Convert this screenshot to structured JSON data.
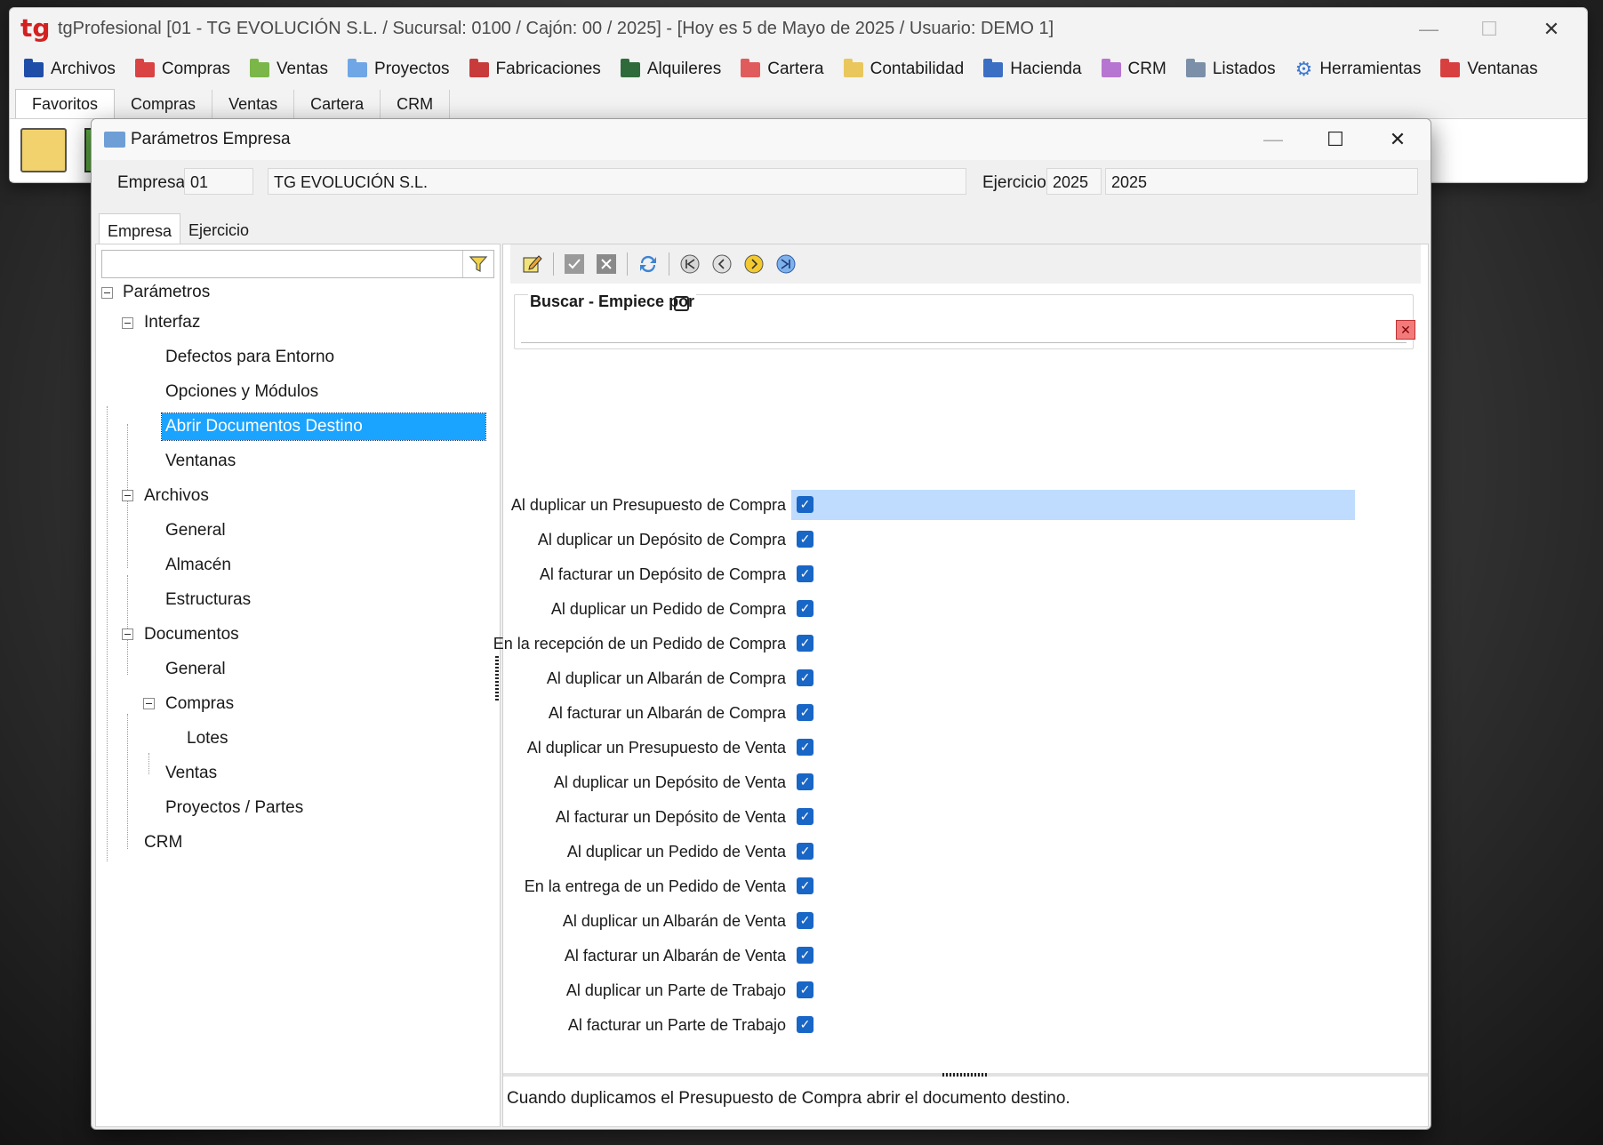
{
  "app": {
    "logo": "tg",
    "title": "tgProfesional [01 - TG EVOLUCIÓN S.L. / Sucursal: 0100 / Cajón: 00 / 2025] - [Hoy es 5 de Mayo de 2025 / Usuario: DEMO 1]",
    "controls": {
      "minimize": "—",
      "maximize": "☐",
      "close": "✕"
    }
  },
  "menu": [
    {
      "label": "Archivos",
      "icon": "folder-blue-icon",
      "color": "#1f4ea8"
    },
    {
      "label": "Compras",
      "icon": "folder-red-icon",
      "color": "#d94343"
    },
    {
      "label": "Ventas",
      "icon": "folder-green-icon",
      "color": "#7ab648"
    },
    {
      "label": "Proyectos",
      "icon": "folder-lightblue-icon",
      "color": "#6fa6e6"
    },
    {
      "label": "Fabricaciones",
      "icon": "factory-icon",
      "color": "#c83b3b"
    },
    {
      "label": "Alquileres",
      "icon": "folder-darkgreen-icon",
      "color": "#2f6b3a"
    },
    {
      "label": "Cartera",
      "icon": "folder-red-icon",
      "color": "#e05c5c"
    },
    {
      "label": "Contabilidad",
      "icon": "folder-yellow-icon",
      "color": "#e9c75d"
    },
    {
      "label": "Hacienda",
      "icon": "hacienda-icon",
      "color": "#3b6fc4"
    },
    {
      "label": "CRM",
      "icon": "folder-purple-icon",
      "color": "#b675d0"
    },
    {
      "label": "Listados",
      "icon": "printer-icon",
      "color": "#7b8fa8"
    },
    {
      "label": "Herramientas",
      "icon": "gear-icon",
      "color": "#3f7ad0"
    },
    {
      "label": "Ventanas",
      "icon": "windows-icon",
      "color": "#d84040"
    }
  ],
  "top_tabs": [
    "Favoritos",
    "Compras",
    "Ventas",
    "Cartera",
    "CRM"
  ],
  "dialog": {
    "title": "Parámetros Empresa",
    "empresa_label": "Empresa",
    "empresa_code": "01",
    "empresa_name": "TG EVOLUCIÓN S.L.",
    "ejercicio_label": "Ejercicio",
    "ejercicio_value": "2025",
    "ejercicio_desc": "2025",
    "tabs": [
      "Empresa",
      "Ejercicio"
    ],
    "tree": {
      "root": "Parámetros",
      "interfaz": "Interfaz",
      "defectos": "Defectos para Entorno",
      "opciones": "Opciones y Módulos",
      "abrir": "Abrir Documentos Destino",
      "ventanas": "Ventanas",
      "archivos": "Archivos",
      "general1": "General",
      "almacen": "Almacén",
      "estructuras": "Estructuras",
      "documentos": "Documentos",
      "general2": "General",
      "compras": "Compras",
      "lotes": "Lotes",
      "ventas": "Ventas",
      "proyectos": "Proyectos / Partes",
      "crm": "CRM"
    },
    "search_label": "Buscar - Empiece por",
    "search_value": "",
    "params": [
      {
        "label": "Al duplicar un Presupuesto de Compra",
        "checked": true
      },
      {
        "label": "Al duplicar un Depósito de Compra",
        "checked": true
      },
      {
        "label": "Al facturar un Depósito de Compra",
        "checked": true
      },
      {
        "label": "Al duplicar un Pedido de Compra",
        "checked": true
      },
      {
        "label": "En la recepción de un Pedido de Compra",
        "checked": true
      },
      {
        "label": "Al duplicar un Albarán de Compra",
        "checked": true
      },
      {
        "label": "Al facturar un Albarán de Compra",
        "checked": true
      },
      {
        "label": "Al duplicar un Presupuesto de Venta",
        "checked": true
      },
      {
        "label": "Al duplicar un Depósito de Venta",
        "checked": true
      },
      {
        "label": "Al facturar un Depósito de Venta",
        "checked": true
      },
      {
        "label": "Al duplicar un Pedido de Venta",
        "checked": true
      },
      {
        "label": "En la entrega de un Pedido de Venta",
        "checked": true
      },
      {
        "label": "Al duplicar un Albarán de Venta",
        "checked": true
      },
      {
        "label": "Al facturar un Albarán de Venta",
        "checked": true
      },
      {
        "label": "Al duplicar un Parte de Trabajo",
        "checked": true
      },
      {
        "label": "Al facturar un Parte de Trabajo",
        "checked": true
      }
    ],
    "help_text": "Cuando duplicamos el Presupuesto de Compra abrir el documento destino.",
    "colors": {
      "selection": "#1aa3ff",
      "row_highlight": "#bfdcff",
      "checkbox": "#1866c6"
    }
  }
}
